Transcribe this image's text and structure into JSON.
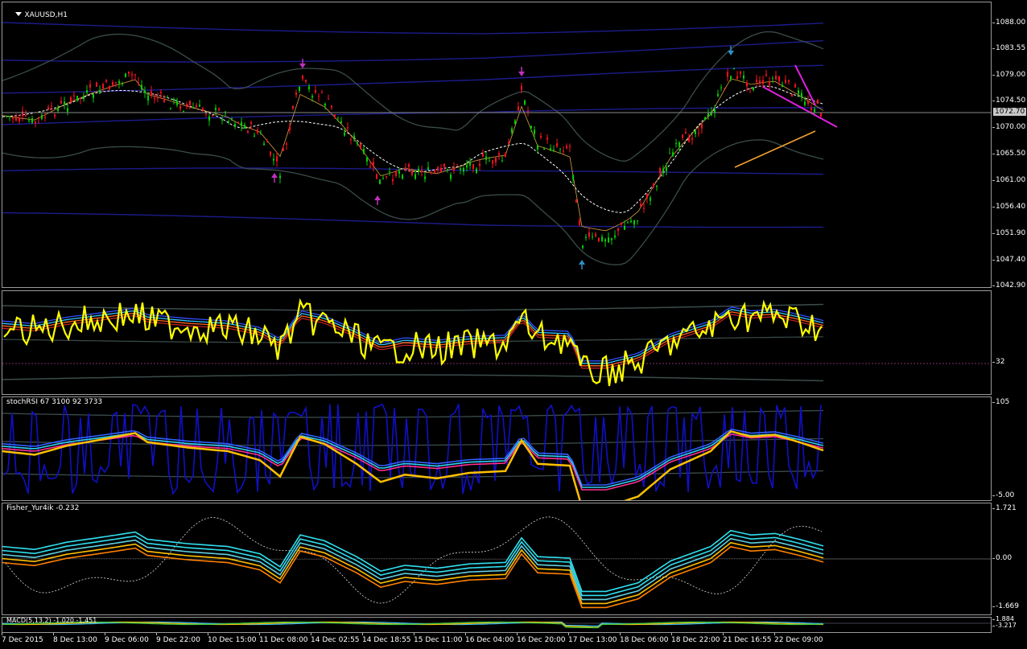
{
  "main": {
    "title": "XAUUSD,H1",
    "price_ticks": [
      "1088.00",
      "1083.55",
      "1079.00",
      "1074.50",
      "1070.00",
      "1065.50",
      "1061.00",
      "1056.40",
      "1051.90",
      "1047.40",
      "1042.90"
    ],
    "current_price": "1072.70"
  },
  "ind1": {
    "ticks": [
      "32"
    ]
  },
  "ind2": {
    "label": "stochRSI 67 3100 92 3733",
    "ticks": [
      "105",
      "-5.00"
    ]
  },
  "ind3": {
    "label": "Fisher_Yur4ik -0.232",
    "ticks": [
      "1.721",
      "0.00",
      "-1.669"
    ]
  },
  "ind4": {
    "label": "MACD(5,13,2) -1.020 -1.451",
    "ticks": [
      "1.884",
      "-3.217"
    ]
  },
  "time_axis": [
    "7 Dec 2015",
    "8 Dec 13:00",
    "9 Dec 06:00",
    "9 Dec 22:00",
    "10 Dec 15:00",
    "11 Dec 08:00",
    "14 Dec 02:55",
    "14 Dec 18:55",
    "15 Dec 11:00",
    "16 Dec 04:00",
    "16 Dec 20:00",
    "17 Dec 13:00",
    "18 Dec 06:00",
    "18 Dec 22:00",
    "21 Dec 16:55",
    "22 Dec 09:00"
  ],
  "colors": {
    "bull_candle": "#00d000",
    "bear_candle": "#ff1020",
    "band_blue": "#1c1c8c",
    "band_gray": "#3c4c4c",
    "trend_magenta": "#e020e0",
    "trend_orange": "#f0a030",
    "rsi_yellow": "#ffff00",
    "stoch_blue": "#1010c8",
    "hist_purple": "#8a18c0",
    "hist_red": "#8a0000",
    "cyan": "#30e0f0",
    "gold": "#ffc000",
    "pink": "#ff1a8c"
  },
  "icons": {
    "symbol_menu": "triangle-down-icon",
    "arrows": "signal-arrow-icon"
  }
}
